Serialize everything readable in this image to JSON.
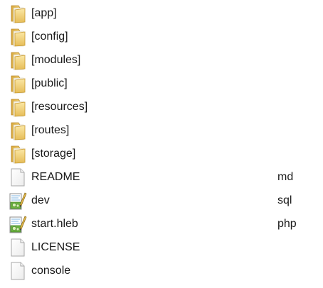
{
  "files": [
    {
      "name": "[app]",
      "ext": "",
      "icon": "folder-icon"
    },
    {
      "name": "[config]",
      "ext": "",
      "icon": "folder-icon"
    },
    {
      "name": "[modules]",
      "ext": "",
      "icon": "folder-icon"
    },
    {
      "name": "[public]",
      "ext": "",
      "icon": "folder-icon"
    },
    {
      "name": "[resources]",
      "ext": "",
      "icon": "folder-icon"
    },
    {
      "name": "[routes]",
      "ext": "",
      "icon": "folder-icon"
    },
    {
      "name": "[storage]",
      "ext": "",
      "icon": "folder-icon"
    },
    {
      "name": "README",
      "ext": "md",
      "icon": "file-icon"
    },
    {
      "name": "dev",
      "ext": "sql",
      "icon": "editor-file-icon"
    },
    {
      "name": "start.hleb",
      "ext": "php",
      "icon": "editor-file-icon"
    },
    {
      "name": "LICENSE",
      "ext": "",
      "icon": "file-icon"
    },
    {
      "name": "console",
      "ext": "",
      "icon": "file-icon"
    }
  ],
  "colors": {
    "folder": "#e8c25a",
    "folder_dark": "#c99a2e",
    "file_border": "#a7a7a7",
    "editor_green": "#5aa03a"
  }
}
